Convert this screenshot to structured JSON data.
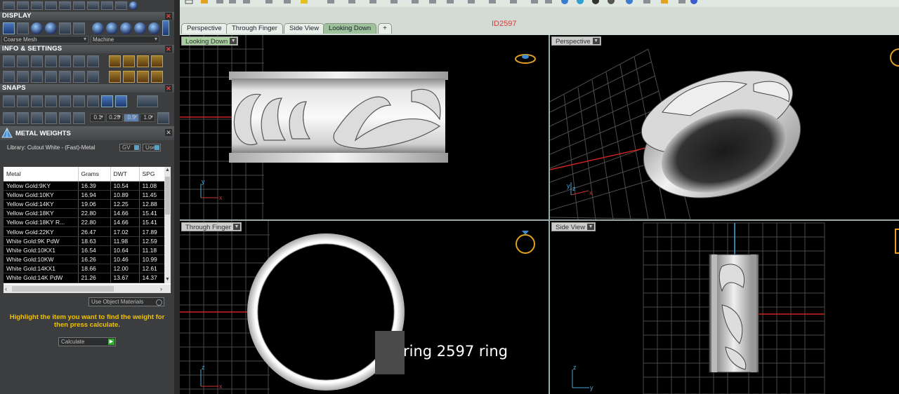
{
  "left_panel": {
    "display": {
      "title": "DISPLAY",
      "mesh_quality": "Coarse Mesh",
      "render_mode": "Machine"
    },
    "info_settings": {
      "title": "INFO & SETTINGS"
    },
    "snaps": {
      "title": "SNAPS",
      "values": [
        "0.1",
        "0.25",
        "0.5",
        "1.0"
      ]
    },
    "metal_weights": {
      "title": "METAL WEIGHTS",
      "library": "Library: Cutout White - (Fast)-Metal",
      "gv_label": "GV",
      "user_label": "User",
      "columns": [
        "Metal",
        "Grams",
        "DWT",
        "SPG"
      ],
      "rows": [
        [
          "Yellow Gold:9KY",
          "16.39",
          "10.54",
          "11.08"
        ],
        [
          "Yellow Gold:10KY",
          "16.94",
          "10.89",
          "11.45"
        ],
        [
          "Yellow Gold:14KY",
          "19.06",
          "12.25",
          "12.88"
        ],
        [
          "Yellow Gold:18KY",
          "22.80",
          "14.66",
          "15.41"
        ],
        [
          "Yellow Gold:18KY R...",
          "22.80",
          "14.66",
          "15.41"
        ],
        [
          "Yellow Gold:22KY",
          "26.47",
          "17.02",
          "17.89"
        ],
        [
          "White Gold:9K PdW",
          "18.63",
          "11.98",
          "12.59"
        ],
        [
          "White Gold:10KX1",
          "16.54",
          "10.64",
          "11.18"
        ],
        [
          "White Gold:10KW",
          "16.26",
          "10.46",
          "10.99"
        ],
        [
          "White Gold:14KX1",
          "18.66",
          "12.00",
          "12.61"
        ],
        [
          "White Gold:14K PdW",
          "21.26",
          "13.67",
          "14.37"
        ]
      ],
      "use_object_materials": "Use Object Materials",
      "hint": "Highlight the item you want to find the weight for then press calculate.",
      "calculate": "Calculate"
    }
  },
  "tabs": [
    "Perspective",
    "Through Finger",
    "Side View",
    "Looking Down"
  ],
  "active_tab": "Looking Down",
  "add_tab_label": "+",
  "id_label": "ID2597",
  "viewports": {
    "looking_down": "Looking Down",
    "perspective": "Perspective",
    "through_finger": "Through Finger",
    "side_view": "Side View"
  },
  "axis_labels": {
    "x": "x",
    "y": "y",
    "z": "z"
  },
  "overlay_text": "ring 2597 ring",
  "colors": {
    "panel_bg": "#3b3d3f",
    "hint_text": "#f2c200",
    "id_label": "#d83a3a",
    "active_tab": "#9ec39a",
    "grid": "#5a5a5a",
    "axis_x": "#cc2222"
  }
}
